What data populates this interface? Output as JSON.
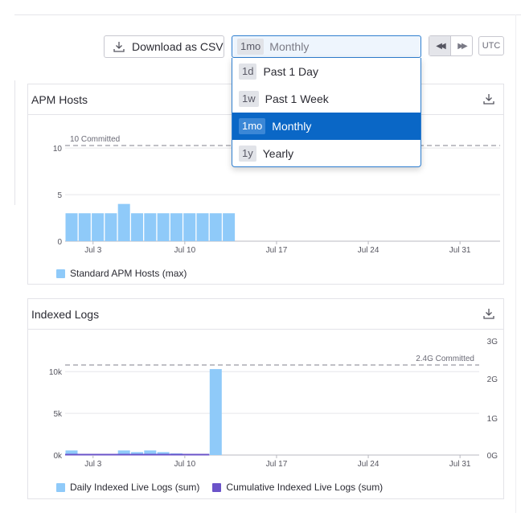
{
  "toolbar": {
    "download_label": "Download as CSV",
    "period_chip": "1mo",
    "period_value": "Monthly",
    "utc_label": "UTC"
  },
  "dropdown": {
    "options": [
      {
        "chip": "1d",
        "label": "Past 1 Day",
        "selected": false
      },
      {
        "chip": "1w",
        "label": "Past 1 Week",
        "selected": false
      },
      {
        "chip": "1mo",
        "label": "Monthly",
        "selected": true
      },
      {
        "chip": "1y",
        "label": "Yearly",
        "selected": false
      }
    ]
  },
  "colors": {
    "accent": "#0a67c6",
    "bar": "#8fcaf9",
    "cumulative": "#6b53c9",
    "committed": "#9a9aa3"
  },
  "panels": {
    "apm": {
      "title": "APM Hosts",
      "legend": [
        "Standard APM Hosts (max)"
      ]
    },
    "logs": {
      "title": "Indexed Logs",
      "legend": [
        "Daily Indexed Live Logs (sum)",
        "Cumulative Indexed Live Logs (sum)"
      ]
    }
  },
  "chart_data": [
    {
      "type": "bar",
      "title": "APM Hosts",
      "x": [
        "Jul 1",
        "Jul 2",
        "Jul 3",
        "Jul 4",
        "Jul 5",
        "Jul 6",
        "Jul 7",
        "Jul 8",
        "Jul 9",
        "Jul 10",
        "Jul 11",
        "Jul 12",
        "Jul 13"
      ],
      "x_ticks": [
        "Jul 3",
        "Jul 10",
        "Jul 17",
        "Jul 24",
        "Jul 31"
      ],
      "y_ticks": [
        "0",
        "5",
        "10"
      ],
      "ylim": [
        0,
        12
      ],
      "series": [
        {
          "name": "Standard APM Hosts (max)",
          "values": [
            3,
            3,
            3,
            3,
            4,
            3,
            3,
            3,
            3,
            3,
            3,
            3,
            3
          ]
        }
      ],
      "committed": {
        "value": 10,
        "label": "10 Committed"
      },
      "grid": true,
      "legend": "bottom-left"
    },
    {
      "type": "bar",
      "title": "Indexed Logs",
      "x": [
        "Jul 1",
        "Jul 2",
        "Jul 3",
        "Jul 4",
        "Jul 5",
        "Jul 6",
        "Jul 7",
        "Jul 8",
        "Jul 9",
        "Jul 10",
        "Jul 11",
        "Jul 12"
      ],
      "x_ticks": [
        "Jul 3",
        "Jul 10",
        "Jul 17",
        "Jul 24",
        "Jul 31"
      ],
      "y_ticks": [
        "0k",
        "5k",
        "10k"
      ],
      "y2_ticks": [
        "0G",
        "1G",
        "2G",
        "3G"
      ],
      "ylim": [
        0,
        10500
      ],
      "series": [
        {
          "name": "Daily Indexed Live Logs (sum)",
          "values": [
            550,
            0,
            0,
            0,
            550,
            350,
            550,
            350,
            200,
            100,
            0,
            10300
          ]
        },
        {
          "name": "Cumulative Indexed Live Logs (sum)",
          "values": [
            0,
            0,
            0,
            0,
            0,
            0,
            0,
            0,
            0,
            0,
            0,
            0
          ]
        }
      ],
      "committed": {
        "value": "2.4G",
        "label": "2.4G Committed"
      },
      "grid": true,
      "legend": "bottom-left"
    }
  ]
}
